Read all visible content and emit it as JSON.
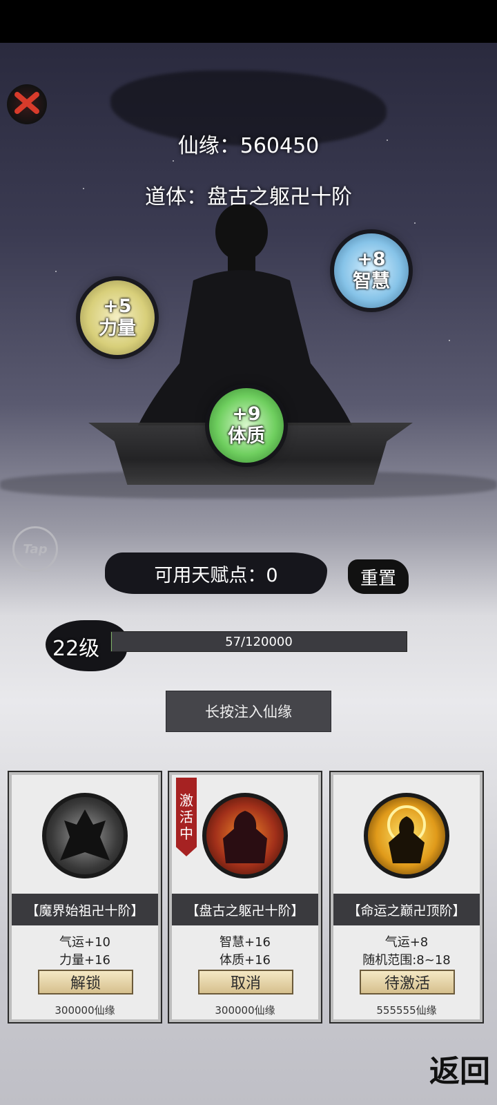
{
  "header": {
    "xianyuan_label": "仙缘：560450",
    "daoti_label": "道体：盘古之躯卍十阶"
  },
  "stats": {
    "strength": {
      "value": "+5",
      "name": "力量"
    },
    "wisdom": {
      "value": "+8",
      "name": "智慧"
    },
    "physique": {
      "value": "+9",
      "name": "体质"
    }
  },
  "tap_label": "Tap",
  "talent": {
    "points_label": "可用天赋点：0",
    "reset_label": "重置"
  },
  "level": {
    "label": "22级",
    "exp_text": "57/120000",
    "progress": 0.000475
  },
  "inject_label": "长按注入仙缘",
  "cards": [
    {
      "title": "【魔界始祖卍十阶】",
      "line1": "气运+10",
      "line2": "力量+16",
      "button": "解锁",
      "cost": "300000仙缘"
    },
    {
      "title": "【盘古之躯卍十阶】",
      "line1": "智慧+16",
      "line2": "体质+16",
      "button": "取消",
      "cost": "300000仙缘",
      "tag": [
        "激",
        "活",
        "中"
      ]
    },
    {
      "title": "【命运之巅卍顶阶】",
      "line1": "气运+8",
      "line2": "随机范围:8~18",
      "button": "待激活",
      "cost": "555555仙缘"
    }
  ],
  "back_label": "返回",
  "icons": {
    "close": "close-icon",
    "tap": "tap-icon",
    "monk": "monk-silhouette"
  },
  "colors": {
    "active_tag": "#a62222",
    "button_gold": "#d6c08e",
    "close_red": "#d83b2b"
  }
}
